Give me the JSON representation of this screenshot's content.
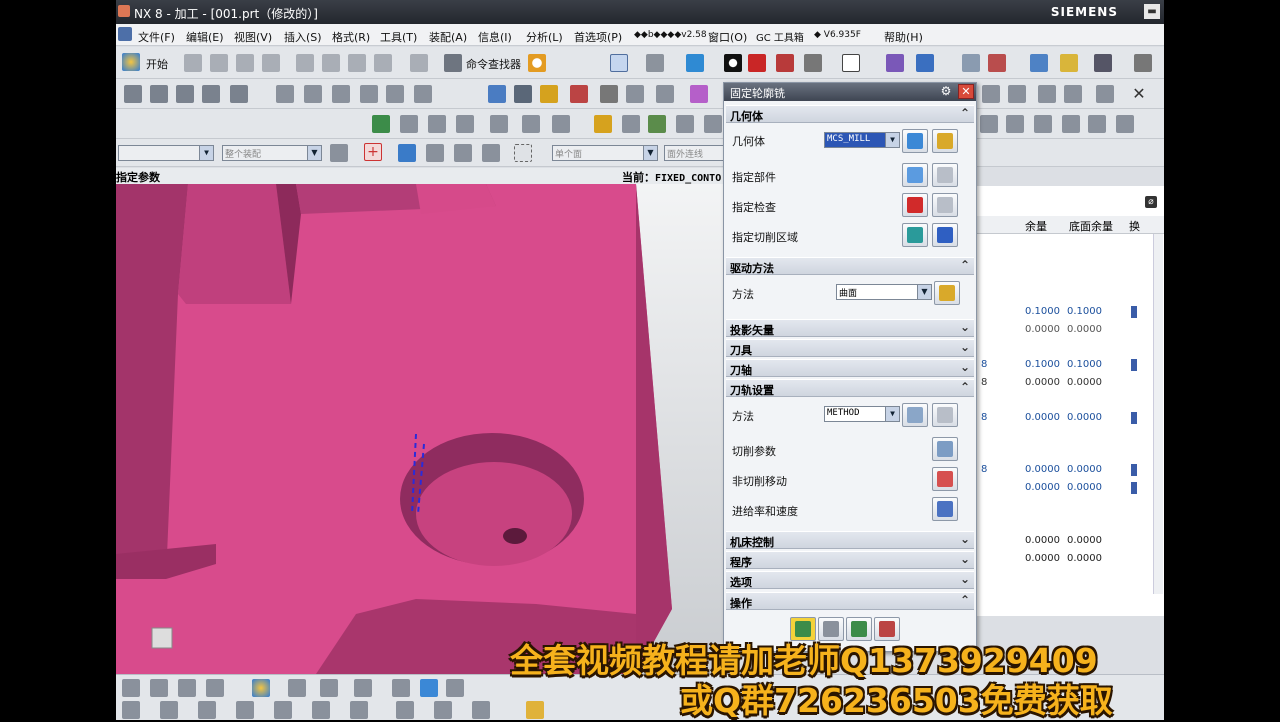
{
  "window": {
    "title": "NX 8 - 加工 - [001.prt（修改的）]",
    "brand": "SIEMENS"
  },
  "menu": [
    "文件(F)",
    "编辑(E)",
    "视图(V)",
    "插入(S)",
    "格式(R)",
    "工具(T)",
    "装配(A)",
    "信息(I)",
    "分析(L)",
    "首选项(P)",
    "◆◆b◆◆◆◆v2.58",
    "窗口(O)",
    "GC 工具箱",
    "◆ V6.935F",
    "帮助(H)"
  ],
  "toolbar": {
    "start_label": "开始",
    "command_finder": "命令查找器",
    "filter1": "",
    "filter2": "整个装配",
    "filter3": "单个面",
    "filter4": "面外连线"
  },
  "graphics": {
    "left_label": "指定参数",
    "current_prefix": "当前：",
    "current_op": "FIXED_CONTO"
  },
  "navigator": {
    "columns": [
      "余量",
      "底面余量",
      "换"
    ],
    "rows": [
      {
        "a": "",
        "b": "0.1000",
        "c": "0.1000"
      },
      {
        "a": "",
        "b": "0.0000",
        "c": "0.0000"
      },
      {
        "a": "8",
        "b": "0.1000",
        "c": "0.1000"
      },
      {
        "a": "8",
        "b": "0.0000",
        "c": "0.0000"
      },
      {
        "a": "8",
        "b": "0.0000",
        "c": "0.0000"
      },
      {
        "a": "8",
        "b": "0.0000",
        "c": "0.0000"
      },
      {
        "a": "",
        "b": "0.0000",
        "c": "0.0000"
      },
      {
        "a": "",
        "b": "0.0000",
        "c": "0.0000"
      },
      {
        "a": "",
        "b": "0.0000",
        "c": "0.0000"
      }
    ]
  },
  "dialog": {
    "title": "固定轮廓铣",
    "close": "✕",
    "sections": {
      "geometry": "几何体",
      "drive": "驱动方法",
      "projection": "投影矢量",
      "tool": "刀具",
      "axis": "刀轴",
      "path": "刀轨设置",
      "machine": "机床控制",
      "program": "程序",
      "options": "选项",
      "actions": "操作"
    },
    "geometry": {
      "label": "几何体",
      "value": "MCS_MILL",
      "part": "指定部件",
      "check": "指定检查",
      "cut_area": "指定切削区域"
    },
    "drive": {
      "label": "方法",
      "value": "曲面"
    },
    "path": {
      "method_label": "方法",
      "method_value": "METHOD",
      "cut_params": "切削参数",
      "non_cut": "非切削移动",
      "feeds": "进给率和速度"
    }
  },
  "overlay": {
    "line1": "全套视频教程请加老师Q1373929409",
    "line2": "或Q群726236503免费获取"
  }
}
